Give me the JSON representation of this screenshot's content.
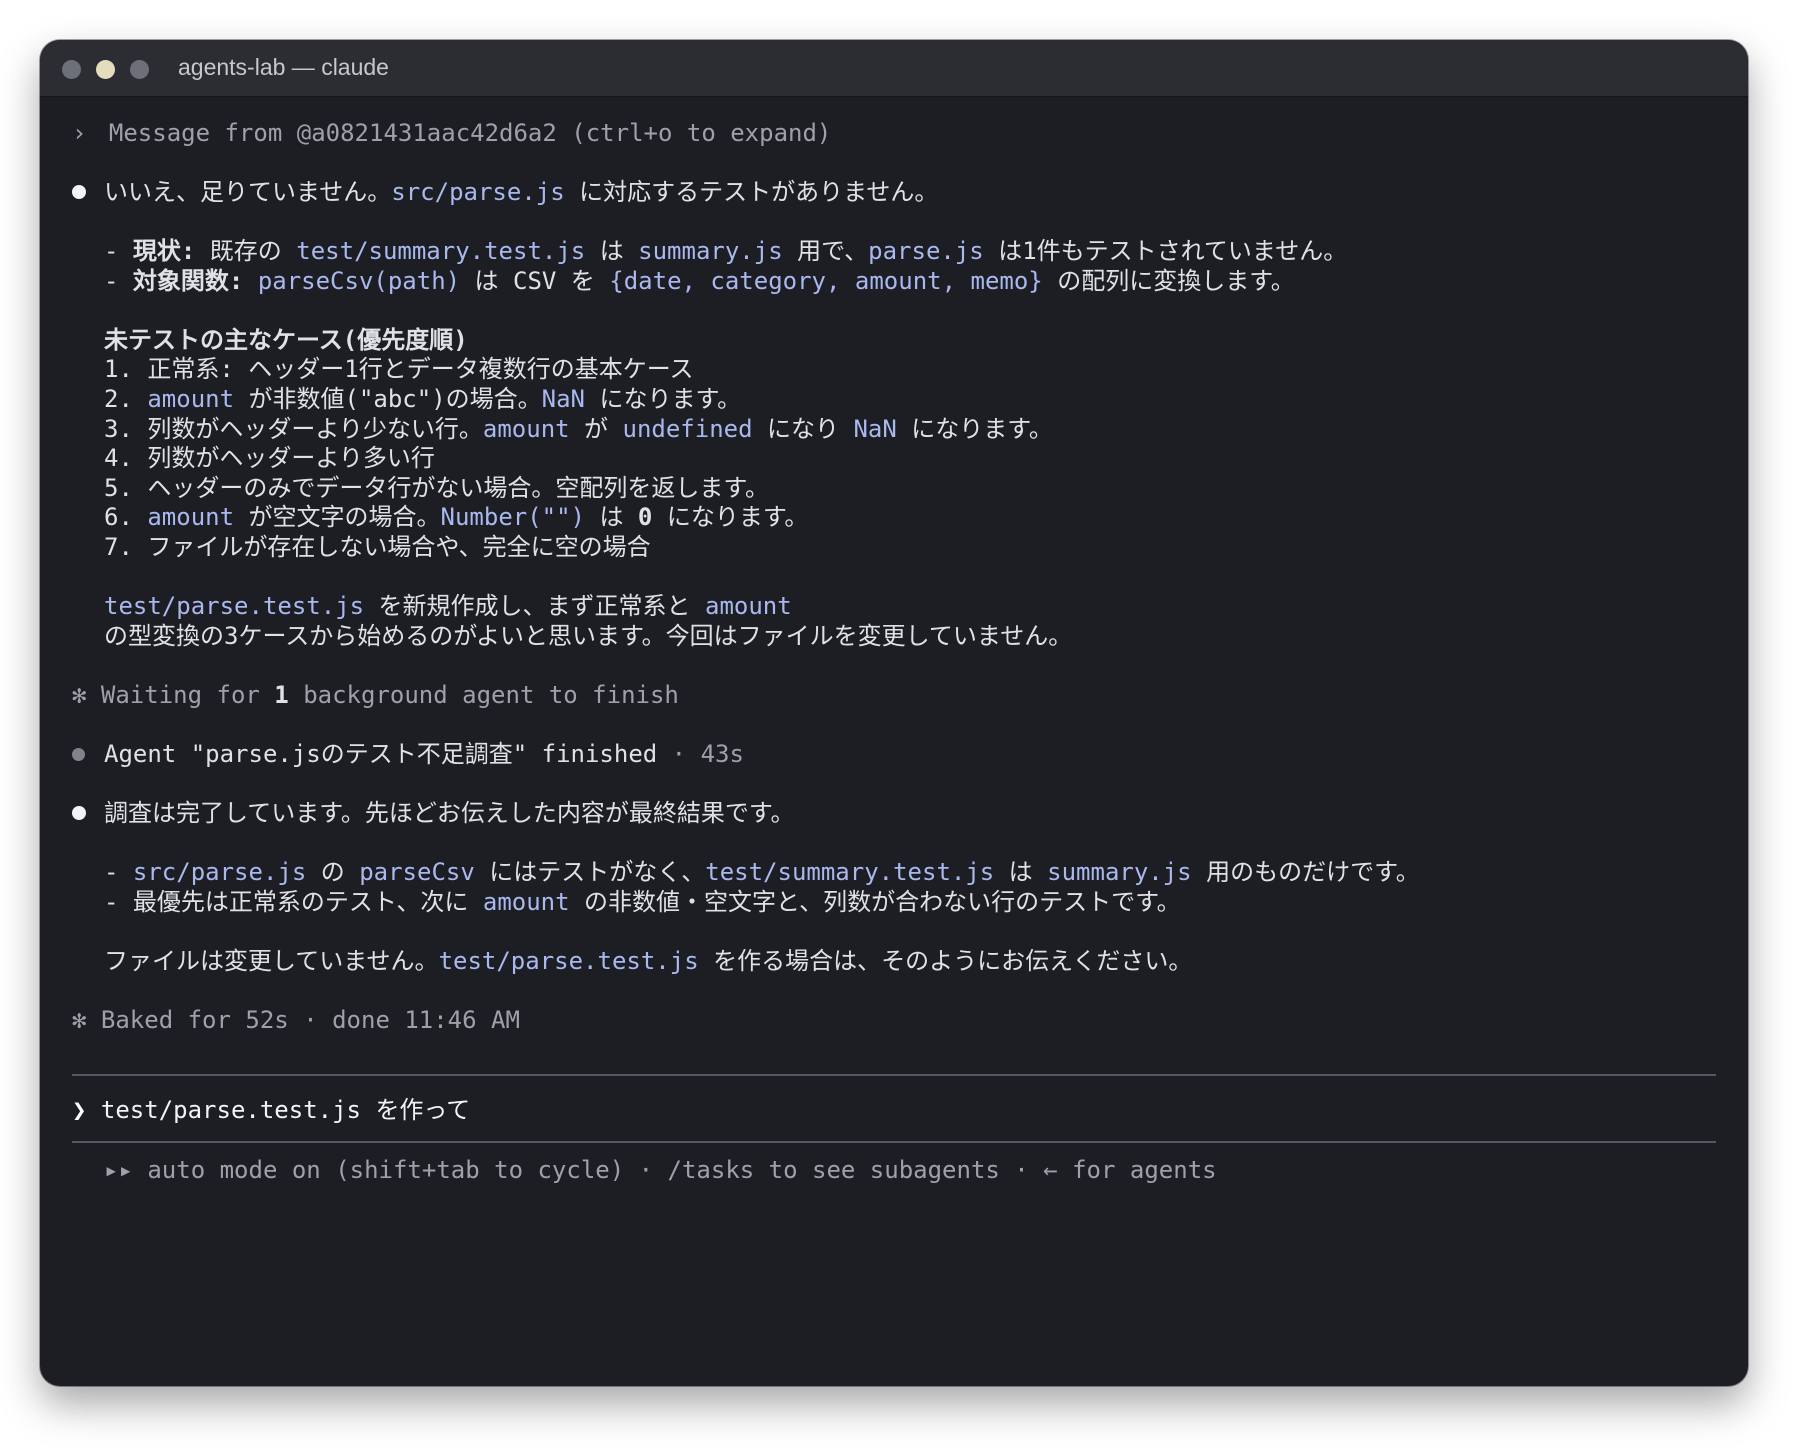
{
  "window": {
    "title": "agents-lab — claude"
  },
  "header": {
    "chevron": "›",
    "message_text": "Message from @a0821431aac42d6a2 (ctrl+o to expand)"
  },
  "reply1": {
    "p1_a": "いいえ、足りていません。",
    "p1_code": "src/parse.js",
    "p1_b": " に対応するテストがありません。",
    "b1_dash": "- ",
    "b1_label": "現状:",
    "b1_a": " 既存の ",
    "b1_code1": "test/summary.test.js",
    "b1_b": " は ",
    "b1_code2": "summary.js",
    "b1_c": " 用で、",
    "b1_code3": "parse.js",
    "b1_d": " は1件もテストされていません。",
    "b2_dash": "- ",
    "b2_label": "対象関数:",
    "b2_a": " ",
    "b2_code1": "parseCsv(path)",
    "b2_b": " は CSV を ",
    "b2_code2": "{date, category, amount, memo}",
    "b2_c": " の配列に変換します。",
    "cases_heading": "未テストの主なケース(優先度順)",
    "c1_a": "1. 正常系: ヘッダー1行とデータ複数行の基本ケース",
    "c2_num": "2. ",
    "c2_code1": "amount",
    "c2_a": " が非数値(\"abc\")の場合。",
    "c2_code2": "NaN",
    "c2_b": " になります。",
    "c3_num": "3. ",
    "c3_a": "列数がヘッダーより少ない行。",
    "c3_code1": "amount",
    "c3_b": " が ",
    "c3_code2": "undefined",
    "c3_c": " になり ",
    "c3_code3": "NaN",
    "c3_d": " になります。",
    "c4_a": "4. 列数がヘッダーより多い行",
    "c5_a": "5. ヘッダーのみでデータ行がない場合。空配列を返します。",
    "c6_num": "6. ",
    "c6_code1": "amount",
    "c6_a": " が空文字の場合。",
    "c6_code2": "Number(\"\")",
    "c6_b": " は ",
    "c6_zero": "0",
    "c6_c": " になります。",
    "c7_a": "7. ファイルが存在しない場合や、完全に空の場合",
    "r1_code1": "test/parse.test.js",
    "r1_a": " を新規作成し、まず正常系と ",
    "r1_code2": "amount",
    "r2_a": "の型変換の3ケースから始めるのがよいと思います。今回はファイルを変更していません。"
  },
  "waiting": {
    "star": "✻",
    "a": " Waiting for ",
    "count": "1",
    "b": " background agent to finish"
  },
  "agent": {
    "text": "Agent \"parse.jsのテスト不足調査\" finished",
    "meta": " · 43s"
  },
  "reply2": {
    "p1": "調査は完了しています。先ほどお伝えした内容が最終結果です。",
    "b1_dash": "- ",
    "b1_code1": "src/parse.js",
    "b1_a": " の ",
    "b1_code2": "parseCsv",
    "b1_b": " にはテストがなく、",
    "b1_code3": "test/summary.test.js",
    "b1_c": " は ",
    "b1_code4": "summary.js",
    "b1_d": " 用のものだけです。",
    "b2_dash": "- ",
    "b2_a": "最優先は正常系のテスト、次に ",
    "b2_code1": "amount",
    "b2_b": " の非数値・空文字と、列数が合わない行のテストです。",
    "c_a": "ファイルは変更していません。",
    "c_code": "test/parse.test.js",
    "c_b": " を作る場合は、そのようにお伝えください。"
  },
  "baked": {
    "star": "✻",
    "text": " Baked for 52s · done 11:46 AM"
  },
  "input": {
    "prompt": "❯",
    "value": " test/parse.test.js を作って"
  },
  "footer": {
    "text": "▸▸ auto mode on (shift+tab to cycle) · /tasks to see subagents · ← for agents"
  },
  "colors": {
    "background": "#1c1e23",
    "code": "#a9b8ee",
    "dim": "#9ea1aa",
    "text": "#dfe1e6"
  }
}
